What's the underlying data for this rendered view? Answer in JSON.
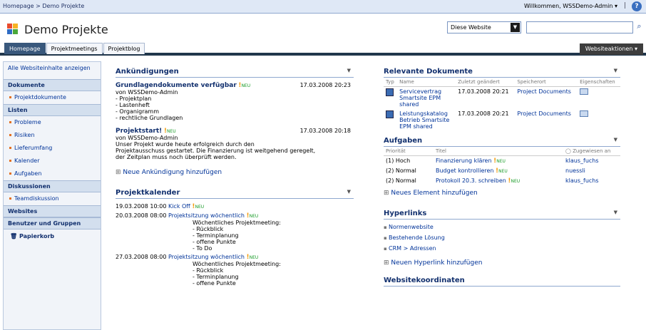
{
  "topbar": {
    "breadcrumb": "Homepage > Demo Projekte",
    "welcome": "Willkommen, WSSDemo-Admin ▾",
    "separator": "|",
    "help": "?"
  },
  "site": {
    "title": "Demo Projekte",
    "scope": "Diese Website",
    "search_value": ""
  },
  "tabs": [
    "Homepage",
    "Projektmeetings",
    "Projektblog"
  ],
  "site_actions": "Websiteaktionen ▾",
  "nav": {
    "all_site_content": "Alle Websiteinhalte anzeigen",
    "sections": [
      {
        "head": "Dokumente",
        "items": [
          "Projektdokumente"
        ]
      },
      {
        "head": "Listen",
        "items": [
          "Probleme",
          "Risiken",
          "Lieferumfang",
          "Kalender",
          "Aufgaben"
        ]
      },
      {
        "head": "Diskussionen",
        "items": [
          "Teamdiskussion"
        ]
      },
      {
        "head": "Websites",
        "items": []
      },
      {
        "head": "Benutzer und Gruppen",
        "items": []
      }
    ],
    "recycle": "Papierkorb"
  },
  "announcements": {
    "title": "Ankündigungen",
    "new_tag": "NEU",
    "items": [
      {
        "title": "Grundlagendokumente verfügbar",
        "date": "17.03.2008 20:23",
        "author": "von WSSDemo-Admin",
        "lines": [
          "- Projektplan",
          "- Lastenheft",
          "- Organigramm",
          "- rechtliche Grundlagen"
        ]
      },
      {
        "title": "Projektstart!",
        "date": "17.03.2008 20:18",
        "author": "von WSSDemo-Admin",
        "lines": [
          "Unser Projekt wurde heute erfolgreich durch den",
          "Projektausschuss gestartet. Die Finanzierung ist weitgehend geregelt,",
          "der Zeitplan muss noch überprüft werden."
        ]
      }
    ],
    "add": "Neue Ankündigung hinzufügen"
  },
  "calendar": {
    "title": "Projektkalender",
    "events": [
      {
        "when": "19.03.2008 10:00",
        "title": "Kick Off",
        "lines": []
      },
      {
        "when": "20.03.2008 08:00",
        "title": "Projektsitzung wöchentlich",
        "lines": [
          "Wöchentliches Projektmeeting:",
          "- Rückblick",
          "- Terminplanung",
          "- offene Punkte",
          "- To Do"
        ]
      },
      {
        "when": "27.03.2008 08:00",
        "title": "Projektsitzung wöchentlich",
        "lines": [
          "Wöchentliches Projektmeeting:",
          "- Rückblick",
          "- Terminplanung",
          "- offene Punkte"
        ]
      }
    ]
  },
  "documents": {
    "title": "Relevante Dokumente",
    "columns": [
      "Typ",
      "Name",
      "Zuletzt geändert",
      "Speicherort",
      "Eigenschaften"
    ],
    "rows": [
      {
        "name": "Servicevertrag Smartsite EPM shared",
        "modified": "17.03.2008 20:21",
        "location": "Project Documents"
      },
      {
        "name": "Leistungskatalog Betrieb Smartsite EPM shared",
        "modified": "17.03.2008 20:21",
        "location": "Project Documents"
      }
    ]
  },
  "tasks": {
    "title": "Aufgaben",
    "columns": [
      "Priorität",
      "Titel",
      "Zugewiesen an"
    ],
    "rows": [
      {
        "priority": "(1) Hoch",
        "title": "Finanzierung klären",
        "assigned": "klaus_fuchs"
      },
      {
        "priority": "(2) Normal",
        "title": "Budget kontrollieren",
        "assigned": "nuessli"
      },
      {
        "priority": "(2) Normal",
        "title": "Protokoll 20.3. schreiben",
        "assigned": "klaus_fuchs"
      }
    ],
    "add": "Neues Element hinzufügen"
  },
  "hyperlinks": {
    "title": "Hyperlinks",
    "items": [
      "Normenwebsite",
      "Bestehende Lösung",
      "CRM > Adressen"
    ],
    "add": "Neuen Hyperlink hinzufügen"
  },
  "next_section": "Websitekoordinaten"
}
